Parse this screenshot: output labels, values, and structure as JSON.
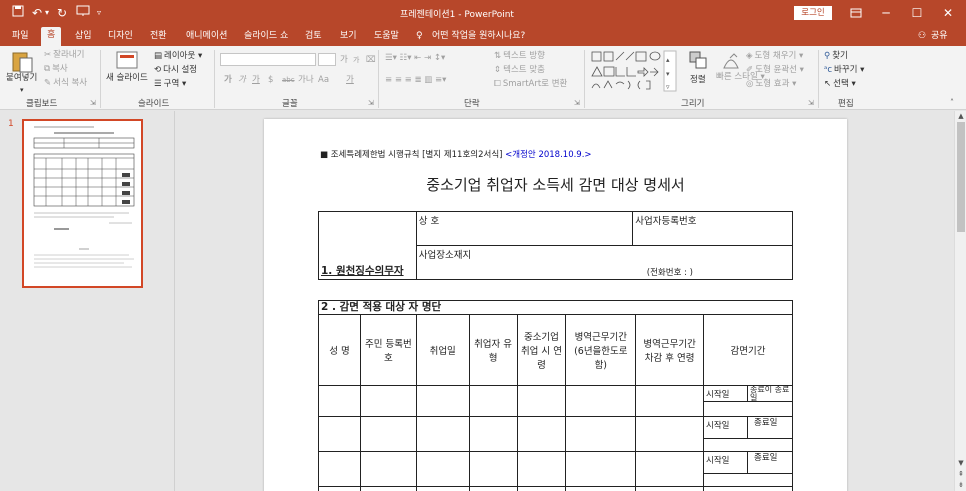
{
  "titlebar": {
    "title": "프레젠테이션1 - PowerPoint",
    "login_label": "로그인",
    "icons": [
      "save-icon",
      "undo-icon",
      "redo-icon",
      "start-slideshow-icon",
      "customize-icon"
    ]
  },
  "tabs": [
    {
      "label": "파일"
    },
    {
      "label": "홈"
    },
    {
      "label": "삽입"
    },
    {
      "label": "디자인"
    },
    {
      "label": "전환"
    },
    {
      "label": "애니메이션"
    },
    {
      "label": "슬라이드 쇼"
    },
    {
      "label": "검토"
    },
    {
      "label": "보기"
    },
    {
      "label": "도움말"
    }
  ],
  "tell_me": "어떤 작업을 원하시나요?",
  "share_label": "공유",
  "ribbon": {
    "clipboard": {
      "paste": "붙여넣기",
      "cut": "잘라내기",
      "copy": "복사",
      "format_painter": "서식 복사",
      "label": "클립보드"
    },
    "slides": {
      "new_slide": "새 슬라이드",
      "layout": "레이아웃",
      "reset": "다시 설정",
      "section": "구역",
      "label": "슬라이드"
    },
    "font": {
      "label": "글꼴",
      "size_up": "가",
      "size_down": "가",
      "bold": "가",
      "italic": "가",
      "underline": "가",
      "strike": "$",
      "spacing": "abc",
      "case": "가나",
      "aa": "Aa",
      "color": "가"
    },
    "paragraph": {
      "text_dir": "텍스트 방향",
      "align_text": "텍스트 맞춤",
      "smartart": "SmartArt로 변환",
      "label": "단락"
    },
    "drawing": {
      "arrange": "정렬",
      "quick_styles": "빠른 스타일",
      "fill": "도형 채우기",
      "outline": "도형 윤곽선",
      "effects": "도형 효과",
      "label": "그리기"
    },
    "editing": {
      "find": "찾기",
      "replace": "바꾸기",
      "select": "선택",
      "label": "편집"
    }
  },
  "slide_number": "1",
  "document": {
    "law_ref": "■ 조세특례제한법 시행규칙 [별지 제11호의2서식]",
    "revision": "<개정안 2018.10.9.>",
    "title": "중소기업 취업자 소득세 감면 대상 명세서",
    "sec1_title": "1. 원천징수의무자",
    "trade_name": "상 호",
    "biz_reg_no": "사업자등록번호",
    "address": "사업장소재지",
    "phone": "(전화번호 :              )",
    "sec2_title": "2 . 감면 적용 대상  자 명단",
    "columns": [
      "성 명",
      "주민 등록번호",
      "취업일",
      "취업자 유형",
      "중소기업 취업 시 연령",
      "병역근무기간 (6년을한도로함)",
      "병역근무기간 차감 후 연령",
      "감면기간"
    ],
    "start_label": "시작일",
    "end_label": "종료일",
    "end_label_first": "종료이 종료일"
  }
}
